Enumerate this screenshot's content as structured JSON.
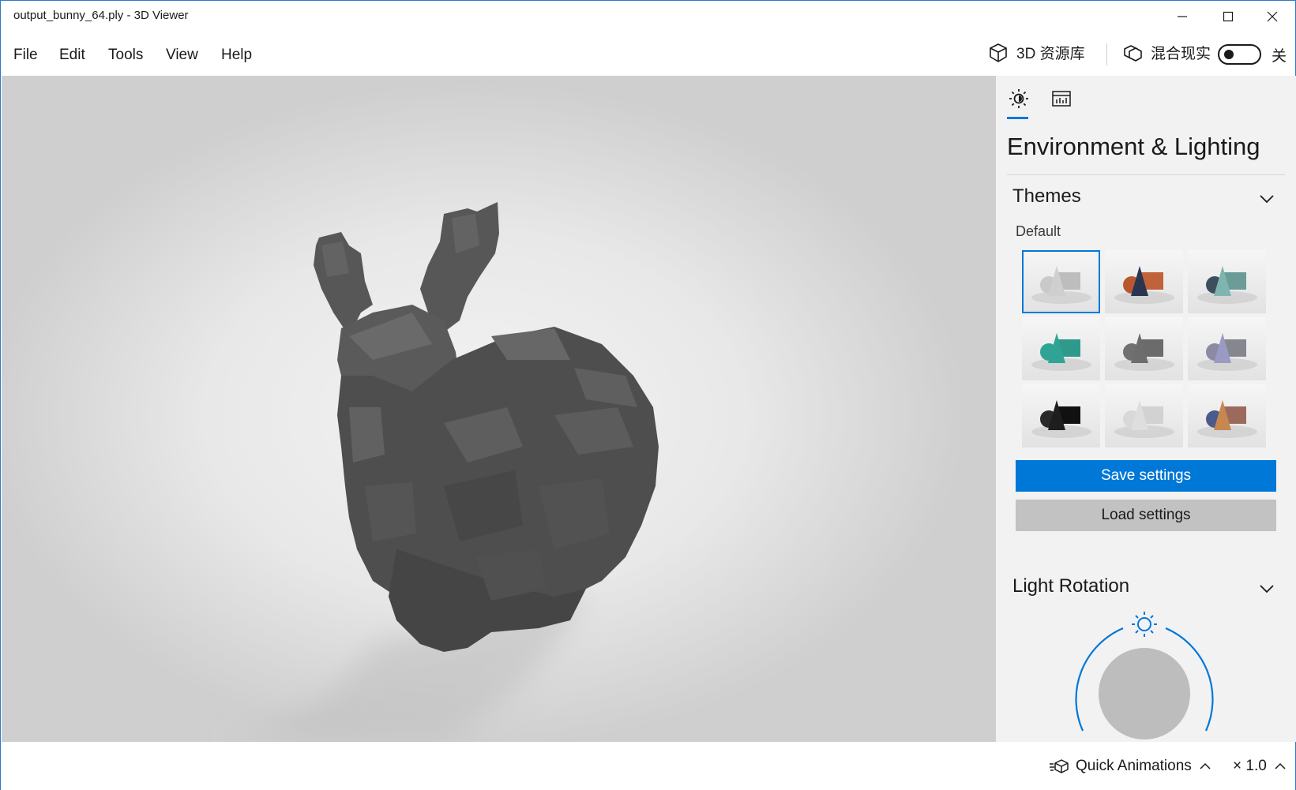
{
  "window": {
    "title": "output_bunny_64.ply - 3D Viewer"
  },
  "menu": {
    "items": [
      "File",
      "Edit",
      "Tools",
      "View",
      "Help"
    ]
  },
  "toolbar": {
    "library_label": "3D 资源库",
    "mixed_reality_label": "混合现实",
    "toggle_state_label": "关"
  },
  "panel": {
    "title": "Environment & Lighting",
    "themes_header": "Themes",
    "themes_group_label": "Default",
    "save_label": "Save settings",
    "load_label": "Load settings",
    "light_rotation_header": "Light Rotation",
    "selected_theme_index": 0,
    "themes": [
      {
        "sphere": "#c9c9c9",
        "cone": "#cfcfcf",
        "box": "#bdbdbd"
      },
      {
        "sphere": "#b9582f",
        "cone": "#2a3650",
        "box": "#c0623a"
      },
      {
        "sphere": "#3b4f5e",
        "cone": "#7fb5b1",
        "box": "#6c9c98"
      },
      {
        "sphere": "#2fa394",
        "cone": "#2fa394",
        "box": "#2e9a8c"
      },
      {
        "sphere": "#707070",
        "cone": "#6d6d6d",
        "box": "#6b6b6b"
      },
      {
        "sphere": "#8a8aa3",
        "cone": "#9a9ac4",
        "box": "#86868e"
      },
      {
        "sphere": "#2a2a2a",
        "cone": "#1e1e1e",
        "box": "#111111"
      },
      {
        "sphere": "#d8d8d8",
        "cone": "#dedede",
        "box": "#d2d2d2"
      },
      {
        "sphere": "#4a5a8a",
        "cone": "#c6884e",
        "box": "#9c6a5c"
      }
    ]
  },
  "status": {
    "quick_animations_label": "Quick Animations",
    "zoom_label": "× 1.0"
  },
  "colors": {
    "accent": "#0078d7",
    "model": "#4a4a4a"
  }
}
